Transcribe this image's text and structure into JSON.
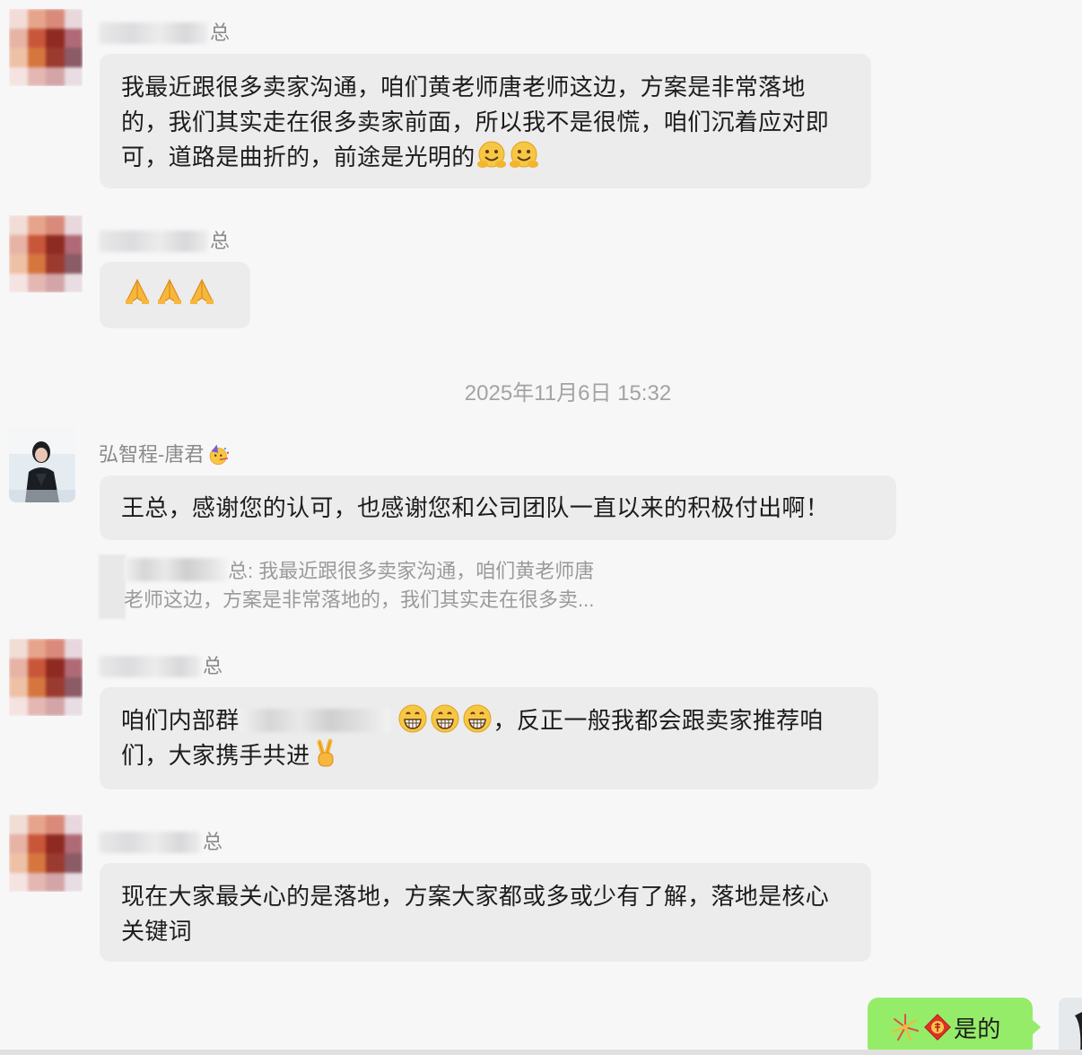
{
  "messages": [
    {
      "sender_suffix": "总",
      "text": "我最近跟很多卖家沟通，咱们黄老师唐老师这边，方案是非常落地的，我们其实走在很多卖家前面，所以我不是很慌，咱们沉着应对即可，道路是曲折的，前途是光明的",
      "emojis": [
        "hug-emoji",
        "hug-emoji"
      ]
    },
    {
      "sender_suffix": "总",
      "text": "",
      "emojis": [
        "pray-emoji",
        "pray-emoji",
        "pray-emoji"
      ]
    },
    {
      "sender_suffix": "总",
      "text_before": "咱们内部群",
      "text_after": "，反正一般我都会跟卖家推荐咱们，大家携手共进",
      "emojis_mid": [
        "grin-emoji",
        "grin-emoji",
        "grin-emoji"
      ],
      "emojis_end": [
        "victory-emoji"
      ]
    },
    {
      "sender_suffix": "总",
      "text": "现在大家最关心的是落地，方案大家都或多或少有了解，落地是核心关键词"
    }
  ],
  "timestamp": "2025年11月6日 15:32",
  "reply": {
    "sender_name": "弘智程-唐君",
    "sender_emoji": "party-face-emoji",
    "text": "王总，感谢您的认可，也感谢您和公司团队一直以来的积极付出啊！",
    "quote_line1": "总: 我最近跟很多卖家沟通，咱们黄老师唐",
    "quote_line2": "老师这边，方案是非常落地的，我们其实走在很多卖...",
    "quote_line2_visible": "老师这边，方案是非常落地的，我们其实走在很多卖..."
  },
  "my_message": {
    "text": "是的",
    "emojis": [
      "fireworks-emoji",
      "fu-emoji"
    ],
    "bubble_color": "#95ec69"
  },
  "colors": {
    "background": "#f7f7f8",
    "bubble": "#ececec",
    "my_bubble": "#95ec69"
  }
}
